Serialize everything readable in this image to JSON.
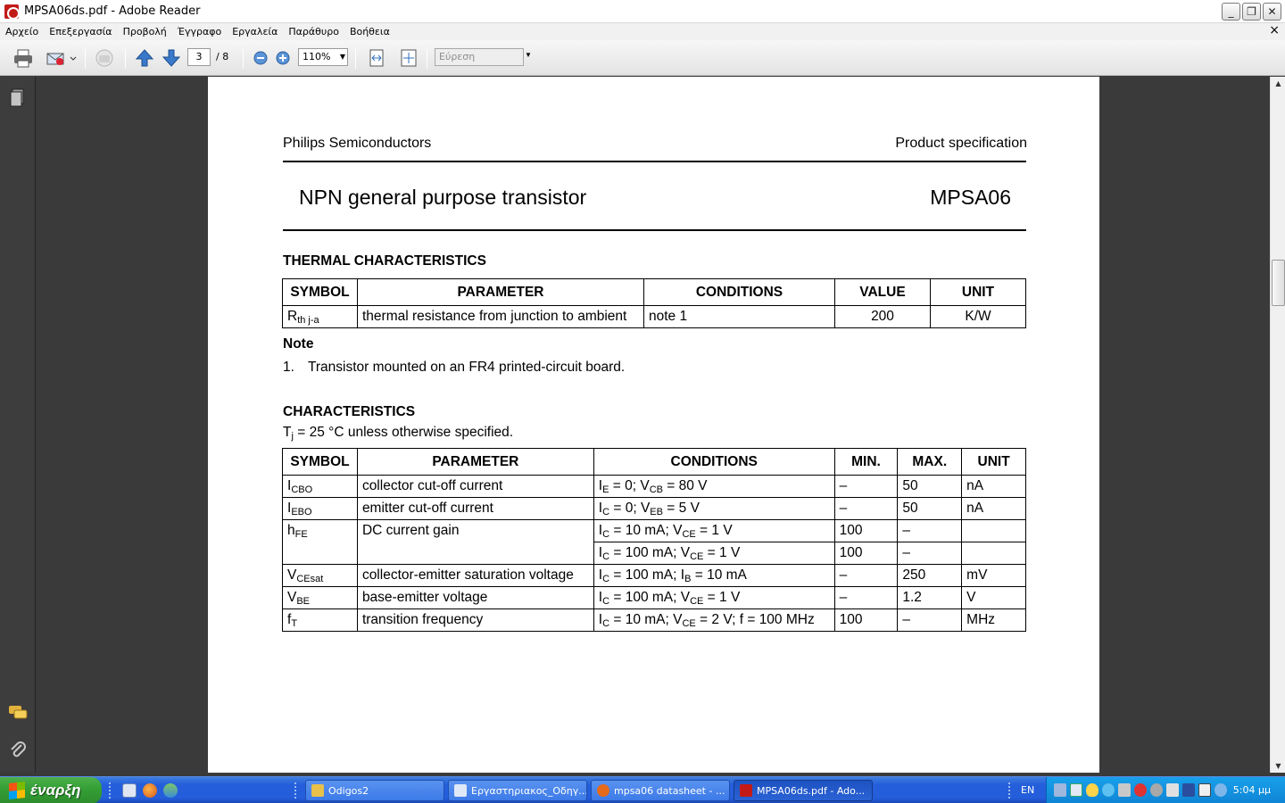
{
  "window": {
    "title": "MPSA06ds.pdf - Adobe Reader",
    "minimize_glyph": "_",
    "maximize_glyph": "❐",
    "close_glyph": "✕",
    "doc_close_glyph": "×"
  },
  "menu": [
    "Αρχείο",
    "Επεξεργασία",
    "Προβολή",
    "Έγγραφο",
    "Εργαλεία",
    "Παράθυρο",
    "Βοήθεια"
  ],
  "toolbar": {
    "current_page": "3",
    "total_pages": "/ 8",
    "zoom": "110%",
    "search_placeholder": "Εύρεση"
  },
  "document": {
    "header_left": "Philips Semiconductors",
    "header_right": "Product specification",
    "title": "NPN general purpose transistor",
    "part_number": "MPSA06",
    "thermal": {
      "section_title": "THERMAL CHARACTERISTICS",
      "headers": [
        "SYMBOL",
        "PARAMETER",
        "CONDITIONS",
        "VALUE",
        "UNIT"
      ],
      "row": {
        "symbol_main": "R",
        "symbol_sub": "th j-a",
        "parameter": "thermal resistance from junction to ambient",
        "conditions": "note 1",
        "value": "200",
        "unit": "K/W"
      }
    },
    "note": {
      "title": "Note",
      "number": "1.",
      "text": "Transistor mounted on an FR4 printed-circuit board."
    },
    "characteristics": {
      "section_title": "CHARACTERISTICS",
      "cond_main": "T",
      "cond_sub": "j",
      "cond_rest": " = 25 °C unless otherwise specified.",
      "headers": [
        "SYMBOL",
        "PARAMETER",
        "CONDITIONS",
        "MIN.",
        "MAX.",
        "UNIT"
      ],
      "rows": [
        {
          "sym": "I",
          "sym_sub": "CBO",
          "param": "collector cut-off current",
          "cond": [
            [
              "I",
              "E",
              " = 0; V",
              "CB",
              " = 80 V"
            ]
          ],
          "min": "–",
          "max": "50",
          "unit": "nA"
        },
        {
          "sym": "I",
          "sym_sub": "EBO",
          "param": "emitter cut-off current",
          "cond": [
            [
              "I",
              "C",
              " = 0; V",
              "EB",
              " = 5 V"
            ]
          ],
          "min": "–",
          "max": "50",
          "unit": "nA"
        },
        {
          "sym": "h",
          "sym_sub": "FE",
          "param": "DC current gain",
          "cond": [
            [
              "I",
              "C",
              " = 10 mA; V",
              "CE",
              " = 1 V"
            ],
            [
              "I",
              "C",
              " = 100 mA; V",
              "CE",
              " = 1 V"
            ]
          ],
          "min_rows": [
            "100",
            "100"
          ],
          "max_rows": [
            "–",
            "–"
          ],
          "unit_rows": [
            "",
            ""
          ]
        },
        {
          "sym": "V",
          "sym_sub": "CEsat",
          "param": "collector-emitter saturation voltage",
          "cond": [
            [
              "I",
              "C",
              " = 100 mA; I",
              "B",
              " = 10 mA"
            ]
          ],
          "min": "–",
          "max": "250",
          "unit": "mV"
        },
        {
          "sym": "V",
          "sym_sub": "BE",
          "param": "base-emitter voltage",
          "cond": [
            [
              "I",
              "C",
              " = 100 mA; V",
              "CE",
              " = 1 V"
            ]
          ],
          "min": "–",
          "max": "1.2",
          "unit": "V"
        },
        {
          "sym": "f",
          "sym_sub": "T",
          "param": "transition frequency",
          "cond": [
            [
              "I",
              "C",
              " = 10 mA; V",
              "CE",
              " = 2 V; f = 100 MHz"
            ]
          ],
          "min": "100",
          "max": "–",
          "unit": "MHz"
        }
      ]
    }
  },
  "taskbar": {
    "start_label": "έναρξη",
    "tasks": [
      {
        "label": "Odigos2",
        "icon_color": "#e8c04a",
        "active": false
      },
      {
        "label": "Εργαστηριακος_Οδηγ...",
        "icon_color": "#dfe8f6",
        "active": false
      },
      {
        "label": "mpsa06 datasheet - ...",
        "icon_color": "#e66a1a",
        "active": false
      },
      {
        "label": "MPSA06ds.pdf - Ado...",
        "icon_color": "#c21b17",
        "active": true
      }
    ],
    "language": "EN",
    "clock": "5:04 μμ"
  },
  "colors": {
    "taskbar_blue": "#245edb",
    "start_green": "#36a036",
    "tray_blue": "#0f84d4",
    "reader_red": "#c21b17"
  }
}
